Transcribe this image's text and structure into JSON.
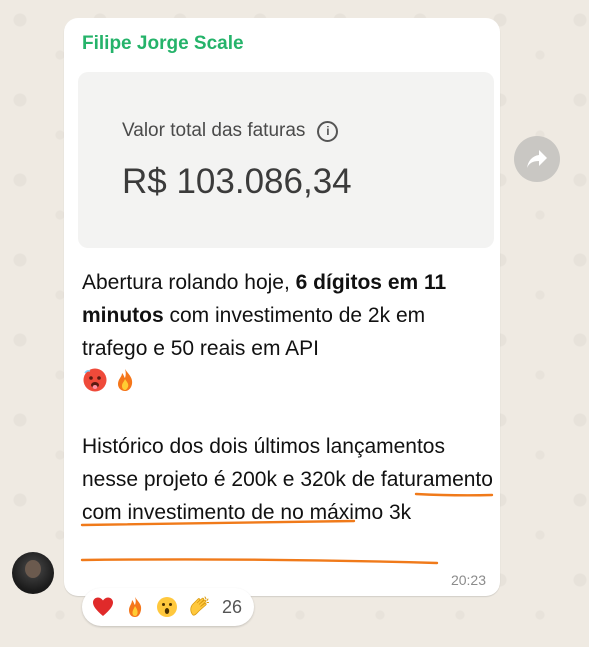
{
  "message": {
    "sender_name": "Filipe Jorge Scale",
    "invoice_label": "Valor total das faturas",
    "invoice_value": "R$ 103.086,34",
    "para1_part1": "Abertura rolando hoje, ",
    "para1_bold": "6 dígitos em 11 minutos",
    "para1_part2": " com investimento de 2k em trafego e 50 reais em API",
    "para1_emojis": [
      "hot-face-icon",
      "fire-icon"
    ],
    "para2": "Histórico dos dois últimos lançamentos nesse projeto é 200k e 320k de faturamento com investimento de no máximo 3k",
    "time": "20:23"
  },
  "reactions": {
    "emojis": [
      "heart-icon",
      "fire-icon",
      "astonished-face-icon",
      "clapping-hands-icon"
    ],
    "count": "26"
  },
  "colors": {
    "sender": "#25b36a",
    "underline": "#f07a1a",
    "background": "#efeae2"
  }
}
